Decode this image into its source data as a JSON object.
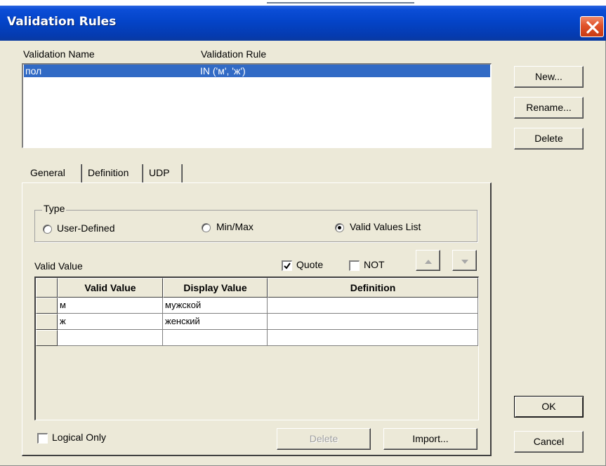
{
  "window": {
    "title": "Validation Rules"
  },
  "list": {
    "headers": [
      "Validation Name",
      "Validation Rule"
    ],
    "rows": [
      {
        "name": "пол",
        "rule": "IN ('м', 'ж')"
      }
    ],
    "selected_color": "#316ac5"
  },
  "side_buttons": {
    "new": "New...",
    "rename": "Rename...",
    "delete": "Delete",
    "ok": "OK",
    "cancel": "Cancel"
  },
  "tabs": [
    "General",
    "Definition",
    "UDP"
  ],
  "general": {
    "type_group": {
      "label": "Type",
      "options": [
        "User-Defined",
        "Min/Max",
        "Valid Values List"
      ],
      "selected": "Valid Values List"
    },
    "valid_value_label": "Valid Value",
    "quote": {
      "label": "Quote",
      "checked": true
    },
    "not": {
      "label": "NOT",
      "checked": false
    },
    "grid": {
      "columns": [
        "Valid Value",
        "Display Value",
        "Definition"
      ],
      "rows": [
        [
          "м",
          "мужской",
          ""
        ],
        [
          "ж",
          "женский",
          ""
        ],
        [
          "",
          "",
          ""
        ]
      ]
    },
    "logical_only": {
      "label": "Logical Only",
      "checked": false
    },
    "delete_button": "Delete",
    "import_button": "Import..."
  },
  "icons": {
    "close": "close-x-icon",
    "up": "arrow-up-icon",
    "down": "arrow-down-icon"
  }
}
